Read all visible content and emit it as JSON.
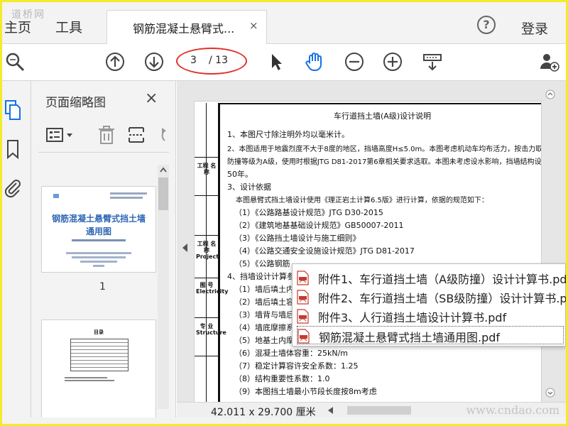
{
  "topbar": {
    "watermark": "道桥网",
    "menu": [
      "主页",
      "工具"
    ],
    "tab_title": "钢筋混凝土悬臂式...",
    "tab_close": "×",
    "help": "?",
    "login": "登录"
  },
  "toolbar": {
    "icons": [
      "search-zoom-icon",
      "page-up-icon",
      "page-down-icon",
      "select-cursor-icon",
      "hand-tool-icon",
      "zoom-out-icon",
      "zoom-in-icon",
      "scroll-mode-icon",
      "add-user-icon"
    ],
    "current_page": "3",
    "total_pages": "/ 13"
  },
  "sidebar": {
    "title": "页面缩略图",
    "close": "×",
    "thumb1_title": "钢筋混凝土悬臂式挡土墙",
    "thumb1_subtitle": "通用图",
    "thumb1_number": "1",
    "thumb2_title": "目录"
  },
  "document": {
    "title": "车行道挡土墙(A级)设计说明",
    "strip_labels": [
      "工程 名 称",
      "工程 名 称 Project",
      "图 号 Electricity",
      "专 业 Structure"
    ],
    "lines": [
      "1、本图尺寸除注明外均以毫米计。",
      "2、本图适用于地震烈度不大于8度的地区，挡墙高度H≤5.0m。本图考虑机动车均布活力，按击力取P=21.25kN，",
      "防撞等级为A级，使用时根据JTG D81-2017第6章相关要求选取。本图未考虑设水影响，挡墙结构设计使用年限为",
      "50年。",
      "3、设计依据",
      "本图悬臂式挡土墙设计使用《理正岩土计算6.5版》进行计算，依据的规范如下：",
      "（1）《公路路基设计规范》JTG D30-2015",
      "（2）《建筑地基基础设计规范》GB50007-2011",
      "（3）《公路挡土墙设计与施工细则》",
      "（4）《公路交通安全设施设计规范》JTG D81-2017",
      "（5）《公路钢筋",
      "4、挡墙设计计算参数",
      "（1）墙后填土内",
      "（2）墙后填土容",
      "（3）墙背与墙后",
      "（4）墙底摩擦系",
      "（5）地基土内摩",
      "（6）混凝土墙体容重：25kN/m",
      "（7）稳定计算容许安全系数：1.25",
      "（8）结构重要性系数：1.0",
      "（9）本图挡土墙最小节段长度按8m考虑"
    ]
  },
  "status": {
    "dimensions": "42.011 x 29.700 厘米",
    "watermark": "www.cndao.com"
  },
  "attachments": [
    "附件1、车行道挡土墙（A级防撞）设计计算书.pdf",
    "附件2、车行道挡土墙（SB级防撞）设计计算书.pdf",
    "附件3、人行道挡土墙设计计算书.pdf",
    "钢筋混凝土悬臂式挡土墙通用图.pdf"
  ],
  "colors": {
    "accent": "#1473e6",
    "highlight_oval": "#e0312a",
    "frame": "#f2ec2a"
  }
}
